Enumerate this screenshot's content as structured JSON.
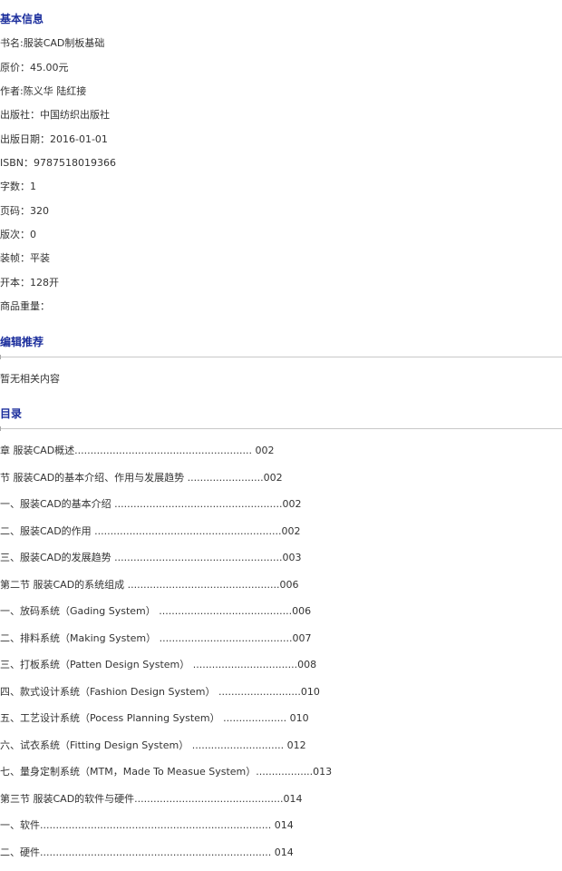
{
  "basic_info": {
    "heading": "基本信息",
    "lines": [
      "书名:服装CAD制板基础",
      "原价：45.00元",
      "作者:陈义华 陆红接",
      "出版社：中国纺织出版社",
      "出版日期：2016-01-01",
      "ISBN：9787518019366",
      "字数：1",
      "页码：320",
      "版次：0",
      "装帧：平装",
      "开本：128开",
      "商品重量："
    ]
  },
  "editor_recommend": {
    "heading": "编辑推荐",
    "content": "暂无相关内容"
  },
  "toc": {
    "heading": "目录",
    "lines": [
      "章 服装CAD概述........................................................ 002",
      "节 服装CAD的基本介绍、作用与发展趋势 ........................002",
      "一、服装CAD的基本介绍 .....................................................002",
      "二、服装CAD的作用 ...........................................................002",
      "三、服装CAD的发展趋势 .....................................................003",
      "第二节 服装CAD的系统组成 ................................................006",
      "一、放码系统（Gading System） ..........................................006",
      "二、排料系统（Making System） ..........................................007",
      "三、打板系统（Patten Design System） .................................008",
      "四、款式设计系统（Fashion Design System） ..........................010",
      "五、工艺设计系统（Pocess Planning System） .................... 010",
      "六、试衣系统（Fitting Design System） ............................. 012",
      "七、量身定制系统（MTM，Made To Measue System）..................013",
      "第三节 服装CAD的软件与硬件...............................................014",
      "一、软件......................................................................... 014",
      "二、硬件......................................................................... 014"
    ]
  }
}
